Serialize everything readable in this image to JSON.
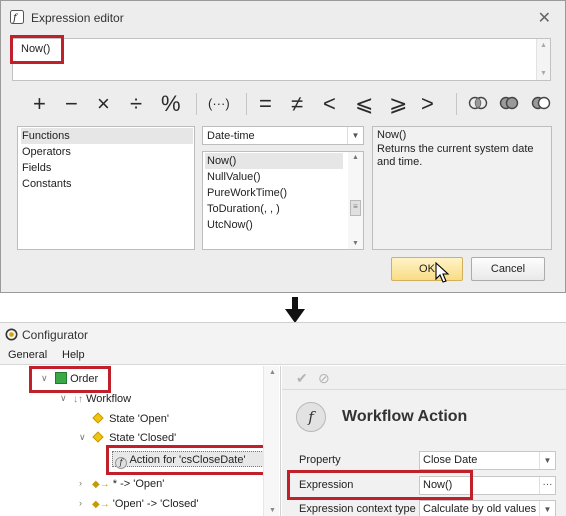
{
  "expression_editor": {
    "title": "Expression editor",
    "close_glyph": "✕",
    "expression_value": "Now()",
    "operators": {
      "plus": "+",
      "minus": "−",
      "multiply": "×",
      "divide": "÷",
      "percent": "%",
      "parens": "(···)",
      "equal": "=",
      "not_equal": "≠",
      "less": "<",
      "less_equal": "⩽",
      "greater_equal": "⩾",
      "greater": ">"
    },
    "logical_icons": [
      "and-rings-icon",
      "or-rings-icon",
      "not-rings-icon"
    ],
    "categories": [
      "Functions",
      "Operators",
      "Fields",
      "Constants"
    ],
    "selected_category": "Functions",
    "function_group": "Date-time",
    "functions": [
      "Now()",
      "NullValue()",
      "PureWorkTime()",
      "ToDuration(, , )",
      "UtcNow()"
    ],
    "selected_function": "Now()",
    "description_title": "Now()",
    "description_text": "Returns the current system date and time.",
    "ok_label": "OK",
    "cancel_label": "Cancel"
  },
  "configurator": {
    "title": "Configurator",
    "menu": [
      "General",
      "Help"
    ],
    "tree": {
      "order": "Order",
      "workflow": "Workflow",
      "state_open": "State 'Open'",
      "state_closed": "State 'Closed'",
      "action": "Action for 'csCloseDate'",
      "transition_any_open": "* -> 'Open'",
      "transition_open_closed": "'Open' -> 'Closed'"
    },
    "panel": {
      "title": "Workflow Action",
      "badge": "f",
      "properties": [
        {
          "label": "Property",
          "value": "Close Date"
        },
        {
          "label": "Expression",
          "value": "Now()"
        },
        {
          "label": "Expression context type",
          "value": "Calculate by old values"
        }
      ]
    },
    "colors": {
      "highlight": "#c0202a",
      "order_icon": "#3aa845",
      "state_diamond": "#f2c40e"
    }
  }
}
